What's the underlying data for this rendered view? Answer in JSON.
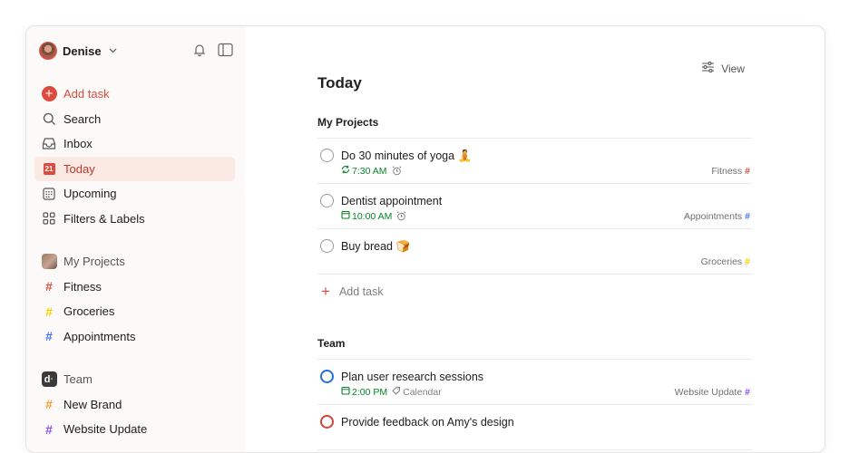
{
  "user": {
    "name": "Denise"
  },
  "sidebar": {
    "nav": [
      {
        "label": "Add task",
        "icon": "add-task-icon"
      },
      {
        "label": "Search",
        "icon": "search-icon"
      },
      {
        "label": "Inbox",
        "icon": "inbox-icon"
      },
      {
        "label": "Today",
        "icon": "today-calendar-icon",
        "day": "21",
        "active": true
      },
      {
        "label": "Upcoming",
        "icon": "upcoming-calendar-icon"
      },
      {
        "label": "Filters & Labels",
        "icon": "filters-grid-icon"
      }
    ],
    "my_projects": {
      "label": "My Projects",
      "items": [
        {
          "label": "Fitness",
          "color": "#dc4c3e"
        },
        {
          "label": "Groceries",
          "color": "#fad000"
        },
        {
          "label": "Appointments",
          "color": "#4073ff"
        }
      ]
    },
    "team": {
      "label": "Team",
      "items": [
        {
          "label": "New Brand",
          "color": "#ff9933"
        },
        {
          "label": "Website Update",
          "color": "#884dff"
        }
      ]
    }
  },
  "main": {
    "view_label": "View",
    "title": "Today",
    "sections": [
      {
        "title": "My Projects",
        "tasks": [
          {
            "title": "Do 30 minutes of yoga 🧘",
            "time": "7:30 AM",
            "time_icon": "recurring-icon",
            "reminder": true,
            "project": "Fitness",
            "project_color": "#dc4c3e"
          },
          {
            "title": "Dentist appointment",
            "time": "10:00 AM",
            "time_icon": "calendar-icon",
            "reminder": true,
            "project": "Appointments",
            "project_color": "#4073ff"
          },
          {
            "title": "Buy bread 🍞",
            "project": "Groceries",
            "project_color": "#fad000"
          }
        ],
        "add_task_label": "Add task"
      },
      {
        "title": "Team",
        "tasks": [
          {
            "title": "Plan user research sessions",
            "time": "2:00 PM",
            "time_icon": "calendar-icon",
            "label": "Calendar",
            "project": "Website Update",
            "project_color": "#884dff",
            "priority_color": "#246fe0"
          },
          {
            "title": "Provide feedback on Amy's design",
            "priority_color": "#d1453b"
          }
        ]
      }
    ]
  }
}
